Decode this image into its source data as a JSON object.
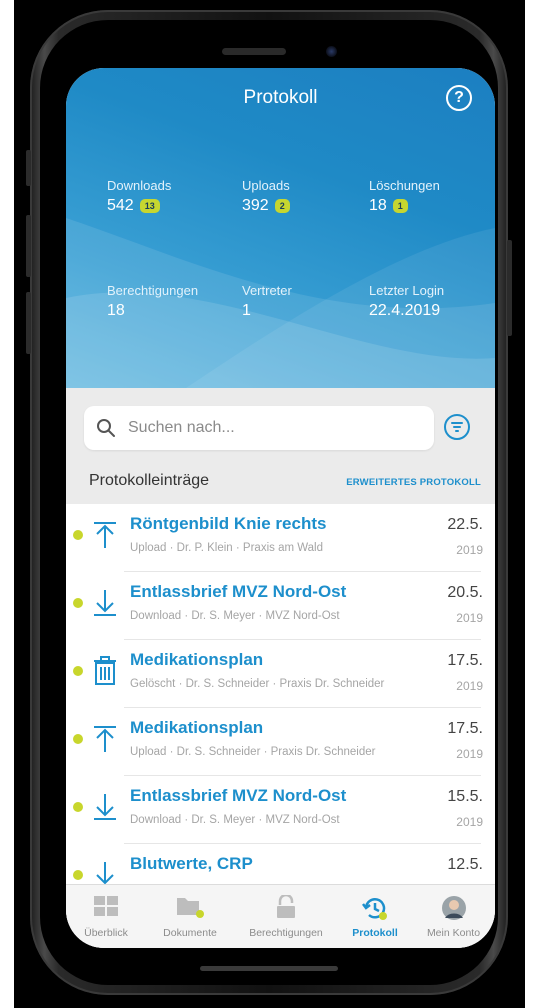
{
  "header": {
    "title": "Protokoll",
    "help_icon": "?"
  },
  "stats": [
    {
      "label": "Downloads",
      "value": "542",
      "badge": "13"
    },
    {
      "label": "Uploads",
      "value": "392",
      "badge": "2"
    },
    {
      "label": "Löschungen",
      "value": "18",
      "badge": "1"
    },
    {
      "label": "Berechtigungen",
      "value": "18"
    },
    {
      "label": "Vertreter",
      "value": "1"
    },
    {
      "label": "Letzter Login",
      "value": "22.4.2019"
    }
  ],
  "search": {
    "placeholder": "Suchen nach..."
  },
  "section": {
    "title": "Protokolleinträge",
    "link": "ERWEITERTES PROTOKOLL"
  },
  "entries": [
    {
      "icon": "upload-icon",
      "title": "Röntgenbild Knie rechts",
      "subtitle": "Upload · Dr. P. Klein · Praxis am Wald",
      "date": "22.5.",
      "year": "2019"
    },
    {
      "icon": "download-icon",
      "title": "Entlassbrief MVZ Nord-Ost",
      "subtitle": "Download · Dr. S. Meyer · MVZ Nord-Ost",
      "date": "20.5.",
      "year": "2019"
    },
    {
      "icon": "trash-icon",
      "title": "Medikationsplan",
      "subtitle": "Gelöscht · Dr. S. Schneider · Praxis Dr. Schneider",
      "date": "17.5.",
      "year": "2019"
    },
    {
      "icon": "upload-icon",
      "title": "Medikationsplan",
      "subtitle": "Upload · Dr. S. Schneider · Praxis Dr. Schneider",
      "date": "17.5.",
      "year": "2019"
    },
    {
      "icon": "download-icon",
      "title": "Entlassbrief MVZ Nord-Ost",
      "subtitle": "Download · Dr. S. Meyer · MVZ Nord-Ost",
      "date": "15.5.",
      "year": "2019"
    },
    {
      "icon": "download-icon",
      "title": "Blutwerte, CRP",
      "subtitle": "",
      "date": "12.5.",
      "year": ""
    }
  ],
  "tabs": [
    {
      "label": "Überblick",
      "icon": "grid-icon"
    },
    {
      "label": "Dokumente",
      "icon": "folder-icon"
    },
    {
      "label": "Berechtigungen",
      "icon": "unlock-icon"
    },
    {
      "label": "Protokoll",
      "icon": "history-icon"
    },
    {
      "label": "Mein Konto",
      "icon": "avatar-icon"
    }
  ],
  "colors": {
    "accent": "#1d8fcc",
    "badge": "#c6d630",
    "dot": "#c8d62c"
  }
}
